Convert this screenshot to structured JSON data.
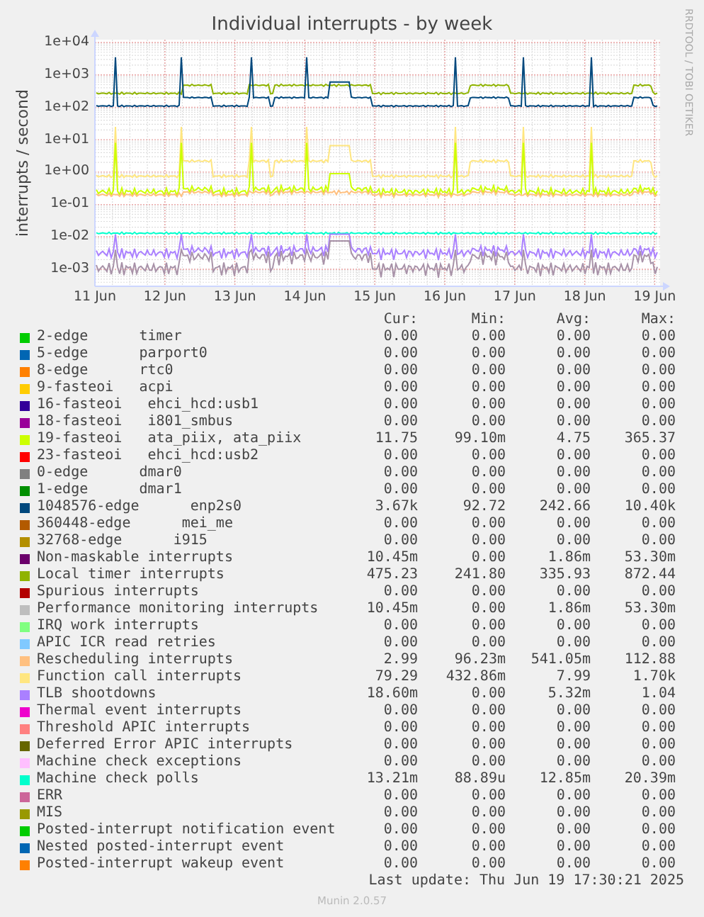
{
  "watermark_side": "RRDTOOL / TOBI OETIKER",
  "graph": {
    "title": "Individual interrupts - by week",
    "ylabel": "interrupts / second",
    "y_axis_labels": [
      "1e+04",
      "1e+03",
      "1e+02",
      "1e+01",
      "1e+00",
      "1e-01",
      "1e-02",
      "1e-03"
    ],
    "x_axis_labels": [
      "11 Jun",
      "12 Jun",
      "13 Jun",
      "14 Jun",
      "15 Jun",
      "16 Jun",
      "17 Jun",
      "18 Jun",
      "19 Jun"
    ]
  },
  "legend": {
    "headers": [
      "Cur:",
      "Min:",
      "Avg:",
      "Max:"
    ],
    "items": [
      {
        "label": "2-edge      timer",
        "color": "#00cc00",
        "cur": "0.00",
        "min": "0.00",
        "avg": "0.00",
        "max": "0.00"
      },
      {
        "label": "5-edge      parport0",
        "color": "#0066b3",
        "cur": "0.00",
        "min": "0.00",
        "avg": "0.00",
        "max": "0.00"
      },
      {
        "label": "8-edge      rtc0",
        "color": "#ff8000",
        "cur": "0.00",
        "min": "0.00",
        "avg": "0.00",
        "max": "0.00"
      },
      {
        "label": "9-fasteoi   acpi",
        "color": "#ffcc00",
        "cur": "0.00",
        "min": "0.00",
        "avg": "0.00",
        "max": "0.00"
      },
      {
        "label": "16-fasteoi   ehci_hcd:usb1",
        "color": "#330099",
        "cur": "0.00",
        "min": "0.00",
        "avg": "0.00",
        "max": "0.00"
      },
      {
        "label": "18-fasteoi   i801_smbus",
        "color": "#990099",
        "cur": "0.00",
        "min": "0.00",
        "avg": "0.00",
        "max": "0.00"
      },
      {
        "label": "19-fasteoi   ata_piix, ata_piix",
        "color": "#ccff00",
        "cur": "11.75",
        "min": "99.10m",
        "avg": "4.75",
        "max": "365.37"
      },
      {
        "label": "23-fasteoi   ehci_hcd:usb2",
        "color": "#ff0000",
        "cur": "0.00",
        "min": "0.00",
        "avg": "0.00",
        "max": "0.00"
      },
      {
        "label": "0-edge      dmar0",
        "color": "#808080",
        "cur": "0.00",
        "min": "0.00",
        "avg": "0.00",
        "max": "0.00"
      },
      {
        "label": "1-edge      dmar1",
        "color": "#008f00",
        "cur": "0.00",
        "min": "0.00",
        "avg": "0.00",
        "max": "0.00"
      },
      {
        "label": "1048576-edge      enp2s0",
        "color": "#00487d",
        "cur": "3.67k",
        "min": "92.72",
        "avg": "242.66",
        "max": "10.40k"
      },
      {
        "label": "360448-edge      mei_me",
        "color": "#b35a00",
        "cur": "0.00",
        "min": "0.00",
        "avg": "0.00",
        "max": "0.00"
      },
      {
        "label": "32768-edge      i915",
        "color": "#b38f00",
        "cur": "0.00",
        "min": "0.00",
        "avg": "0.00",
        "max": "0.00"
      },
      {
        "label": "Non-maskable interrupts",
        "color": "#6b006b",
        "cur": "10.45m",
        "min": "0.00",
        "avg": "1.86m",
        "max": "53.30m"
      },
      {
        "label": "Local timer interrupts",
        "color": "#8fb300",
        "cur": "475.23",
        "min": "241.80",
        "avg": "335.93",
        "max": "872.44"
      },
      {
        "label": "Spurious interrupts",
        "color": "#b30000",
        "cur": "0.00",
        "min": "0.00",
        "avg": "0.00",
        "max": "0.00"
      },
      {
        "label": "Performance monitoring interrupts",
        "color": "#bebebe",
        "cur": "10.45m",
        "min": "0.00",
        "avg": "1.86m",
        "max": "53.30m"
      },
      {
        "label": "IRQ work interrupts",
        "color": "#80ff80",
        "cur": "0.00",
        "min": "0.00",
        "avg": "0.00",
        "max": "0.00"
      },
      {
        "label": "APIC ICR read retries",
        "color": "#80c9ff",
        "cur": "0.00",
        "min": "0.00",
        "avg": "0.00",
        "max": "0.00"
      },
      {
        "label": "Rescheduling interrupts",
        "color": "#ffc080",
        "cur": "2.99",
        "min": "96.23m",
        "avg": "541.05m",
        "max": "112.88"
      },
      {
        "label": "Function call interrupts",
        "color": "#ffe680",
        "cur": "79.29",
        "min": "432.86m",
        "avg": "7.99",
        "max": "1.70k"
      },
      {
        "label": "TLB shootdowns",
        "color": "#aa80ff",
        "cur": "18.60m",
        "min": "0.00",
        "avg": "5.32m",
        "max": "1.04"
      },
      {
        "label": "Thermal event interrupts",
        "color": "#ee00cc",
        "cur": "0.00",
        "min": "0.00",
        "avg": "0.00",
        "max": "0.00"
      },
      {
        "label": "Threshold APIC interrupts",
        "color": "#ff8080",
        "cur": "0.00",
        "min": "0.00",
        "avg": "0.00",
        "max": "0.00"
      },
      {
        "label": "Deferred Error APIC interrupts",
        "color": "#666600",
        "cur": "0.00",
        "min": "0.00",
        "avg": "0.00",
        "max": "0.00"
      },
      {
        "label": "Machine check exceptions",
        "color": "#ffbfff",
        "cur": "0.00",
        "min": "0.00",
        "avg": "0.00",
        "max": "0.00"
      },
      {
        "label": "Machine check polls",
        "color": "#00ffcc",
        "cur": "13.21m",
        "min": "88.89u",
        "avg": "12.85m",
        "max": "20.39m"
      },
      {
        "label": "ERR",
        "color": "#cc6699",
        "cur": "0.00",
        "min": "0.00",
        "avg": "0.00",
        "max": "0.00"
      },
      {
        "label": "MIS",
        "color": "#999900",
        "cur": "0.00",
        "min": "0.00",
        "avg": "0.00",
        "max": "0.00"
      },
      {
        "label": "Posted-interrupt notification event",
        "color": "#00cc00",
        "cur": "0.00",
        "min": "0.00",
        "avg": "0.00",
        "max": "0.00"
      },
      {
        "label": "Nested posted-interrupt event",
        "color": "#0066b3",
        "cur": "0.00",
        "min": "0.00",
        "avg": "0.00",
        "max": "0.00"
      },
      {
        "label": "Posted-interrupt wakeup event",
        "color": "#ff8000",
        "cur": "0.00",
        "min": "0.00",
        "avg": "0.00",
        "max": "0.00"
      }
    ]
  },
  "last_update": "Last update: Thu Jun 19 17:30:21 2025",
  "footer": "Munin 2.0.57"
}
